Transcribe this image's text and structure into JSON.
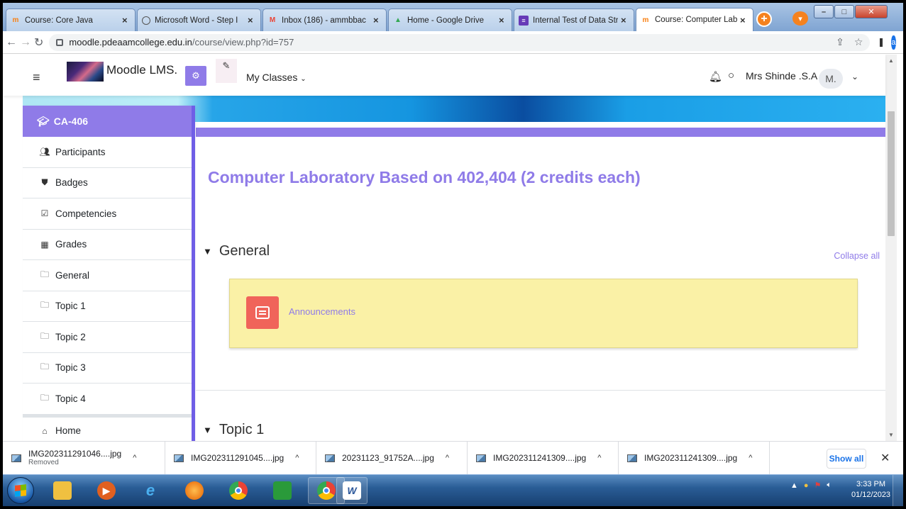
{
  "browser": {
    "tabs": [
      {
        "title": "Course: Core Java",
        "icon": "moodle-icon",
        "color": "#f98012"
      },
      {
        "title": "Microsoft Word - Step I",
        "icon": "globe-icon",
        "color": "#555555"
      },
      {
        "title": "Inbox (186) - ammbbac",
        "icon": "gmail-icon",
        "color": "#ea4335"
      },
      {
        "title": "Home - Google Drive",
        "icon": "drive-icon",
        "color": "#34a853"
      },
      {
        "title": "Internal Test of Data Str",
        "icon": "forms-icon",
        "color": "#673ab7"
      },
      {
        "title": "Course: Computer Labo",
        "icon": "moodle-icon",
        "color": "#f98012",
        "active": true
      }
    ],
    "new_tab": "+",
    "url_host": "moodle.pdeaamcollege.edu.in",
    "url_path": "/course/view.php?id=757",
    "profile_initial": "a"
  },
  "header": {
    "site_name": "Moodle LMS.",
    "nav_label": "My Classes",
    "user_name": "Mrs Shinde .S.A",
    "avatar_initials": "M."
  },
  "course_nav": {
    "course_short": "CA-406",
    "items": [
      {
        "label": "Participants",
        "icon": "users-icon"
      },
      {
        "label": "Badges",
        "icon": "shield-icon"
      },
      {
        "label": "Competencies",
        "icon": "checkbox-icon"
      },
      {
        "label": "Grades",
        "icon": "table-icon"
      },
      {
        "label": "General",
        "icon": "folder-icon"
      },
      {
        "label": "Topic 1",
        "icon": "folder-icon"
      },
      {
        "label": "Topic 2",
        "icon": "folder-icon"
      },
      {
        "label": "Topic 3",
        "icon": "folder-icon"
      },
      {
        "label": "Topic 4",
        "icon": "folder-icon"
      }
    ],
    "home_label": "Home"
  },
  "main": {
    "course_title": "Computer Laboratory Based on 402,404 (2 credits each)",
    "collapse_all": "Collapse all",
    "sections": [
      {
        "name": "General",
        "activities": [
          {
            "label": "Announcements",
            "icon": "forum-icon"
          }
        ]
      },
      {
        "name": "Topic 1"
      }
    ]
  },
  "downloads": {
    "items": [
      {
        "name": "IMG202311291046....jpg",
        "status": "Removed"
      },
      {
        "name": "IMG202311291045....jpg",
        "status": ""
      },
      {
        "name": "20231123_91752A....jpg",
        "status": ""
      },
      {
        "name": "IMG202311241309....jpg",
        "status": ""
      },
      {
        "name": "IMG202311241309....jpg",
        "status": ""
      }
    ],
    "show_all": "Show all"
  },
  "taskbar": {
    "time": "3:33 PM",
    "date": "01/12/2023"
  },
  "colors": {
    "accent": "#8f7be8",
    "nav_border": "#6f5ee6",
    "activity_bg": "#faf1a6",
    "forum_icon": "#f0645a"
  }
}
